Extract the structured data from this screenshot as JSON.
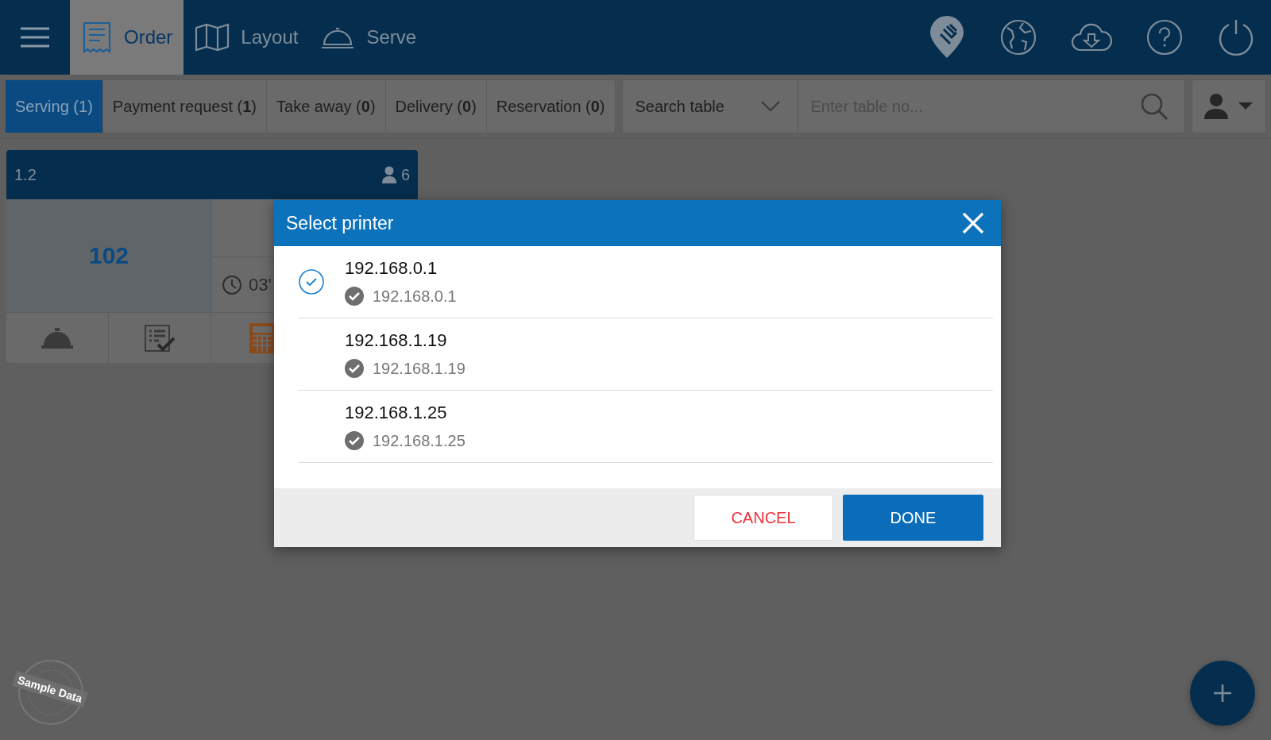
{
  "top_nav": {
    "tabs": [
      {
        "label": "Order",
        "kind": "receipt",
        "selected": true
      },
      {
        "label": "Layout",
        "kind": "map",
        "selected": false
      },
      {
        "label": "Serve",
        "kind": "cloche",
        "selected": false
      }
    ]
  },
  "filter_tabs": [
    {
      "label": "Serving (1)",
      "selected": true
    },
    {
      "label": "Payment request (**1**)",
      "selected": false
    },
    {
      "label": "Take away (**0**)",
      "selected": false
    },
    {
      "label": "Delivery (**0**)",
      "selected": false
    },
    {
      "label": "Reservation (**0**)",
      "selected": false
    }
  ],
  "search": {
    "mode": "Search table",
    "placeholder": "Enter table no..."
  },
  "table_card": {
    "name": "1.2",
    "guests": "6",
    "number": "102",
    "time": "03'"
  },
  "dialog": {
    "title": "Select printer",
    "printers": [
      {
        "name": "192.168.0.1",
        "address": "192.168.0.1",
        "selected": true
      },
      {
        "name": "192.168.1.19",
        "address": "192.168.1.19",
        "selected": false
      },
      {
        "name": "192.168.1.25",
        "address": "192.168.1.25",
        "selected": false
      }
    ],
    "cancel": "CANCEL",
    "done": "DONE"
  },
  "badge": "Sample Data"
}
